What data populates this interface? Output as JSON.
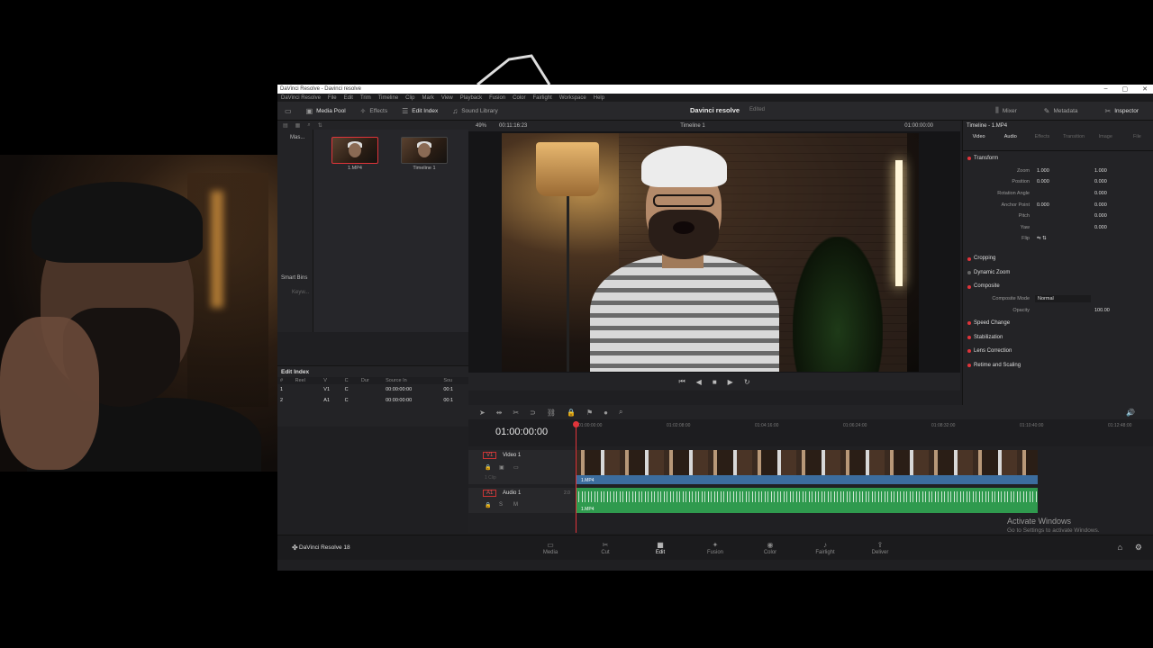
{
  "window": {
    "title": "DaVinci Resolve - Davinci resolve",
    "controls": [
      "–",
      "▢",
      "✕"
    ]
  },
  "menu": [
    "DaVinci Resolve",
    "File",
    "Edit",
    "Trim",
    "Timeline",
    "Clip",
    "Mark",
    "View",
    "Playback",
    "Fusion",
    "Color",
    "Fairlight",
    "Workspace",
    "Help"
  ],
  "toolbar": {
    "media_pool": "Media Pool",
    "effects": "Effects",
    "edit_index": "Edit Index",
    "sound_library": "Sound Library",
    "project_title": "Davinci resolve",
    "project_status": "Edited",
    "mixer": "Mixer",
    "metadata": "Metadata",
    "inspector": "Inspector"
  },
  "bins": {
    "master": "Mas...",
    "smart_bins": "Smart Bins",
    "keywords": "Keyw..."
  },
  "media_pool": {
    "clips": [
      {
        "name": "1.MP4"
      },
      {
        "name": "Timeline 1"
      }
    ]
  },
  "edit_index": {
    "title": "Edit Index",
    "columns": [
      "#",
      "Reel",
      "V",
      "C",
      "Dur",
      "Source In",
      "Sou"
    ],
    "rows": [
      [
        "1",
        "",
        "V1",
        "C",
        "",
        "00:00:00:00",
        "00:1"
      ],
      [
        "2",
        "",
        "A1",
        "C",
        "",
        "00:00:00:00",
        "00:1"
      ]
    ]
  },
  "viewer": {
    "zoom": "49%",
    "duration": "00:11:16:23",
    "timeline_name": "Timeline 1",
    "timecode": "01:00:00:00"
  },
  "inspector": {
    "title": "Timeline - 1.MP4",
    "tabs": [
      "Video",
      "Audio",
      "Effects",
      "Transition",
      "Image",
      "File"
    ],
    "transform": {
      "title": "Transform",
      "rows": [
        {
          "label": "Zoom",
          "x": "1.000",
          "y": "1.000"
        },
        {
          "label": "Position",
          "x": "0.000",
          "y": "0.000"
        },
        {
          "label": "Rotation Angle",
          "x": "",
          "y": "0.000"
        },
        {
          "label": "Anchor Point",
          "x": "0.000",
          "y": "0.000"
        },
        {
          "label": "Pitch",
          "x": "",
          "y": "0.000"
        },
        {
          "label": "Yaw",
          "x": "",
          "y": "0.000"
        },
        {
          "label": "Flip",
          "x": "",
          "y": ""
        }
      ]
    },
    "cropping": "Cropping",
    "dynamic_zoom": "Dynamic Zoom",
    "composite": {
      "title": "Composite",
      "mode_label": "Composite Mode",
      "mode": "Normal",
      "opacity_label": "Opacity",
      "opacity": "100.00"
    },
    "sections": [
      "Speed Change",
      "Stabilization",
      "Lens Correction",
      "Retime and Scaling"
    ]
  },
  "timeline": {
    "timecode": "01:00:00:00",
    "ruler": [
      "01:00:00:00",
      "01:02:08:00",
      "01:04:16:00",
      "01:06:24:00",
      "01:08:32:00",
      "01:10:40:00",
      "01:12:48:00"
    ],
    "video_track": {
      "id": "V1",
      "name": "Video 1",
      "clips_info": "1 Clip",
      "clip": "1.MP4"
    },
    "audio_track": {
      "id": "A1",
      "name": "Audio 1",
      "level": "2.0",
      "clip": "1.MP4"
    }
  },
  "pages": [
    "Media",
    "Cut",
    "Edit",
    "Fusion",
    "Color",
    "Fairlight",
    "Deliver"
  ],
  "active_page": "Edit",
  "brand": "DaVinci Resolve 18",
  "watermark": {
    "line1": "Activate Windows",
    "line2": "Go to Settings to activate Windows."
  },
  "colors": {
    "accent": "#e0343a",
    "video_clip": "#3c6d9e",
    "audio_clip": "#2f9a4e"
  }
}
